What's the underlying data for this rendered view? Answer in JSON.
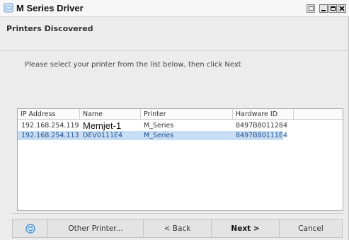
{
  "window": {
    "title": "M Series Driver",
    "header_title": "Printers Discovered",
    "instruction": "Please select your printer from the list below, then click Next"
  },
  "title_icon": "printer-app-icon",
  "list": {
    "columns": [
      "IP Address",
      "Name",
      "Printer",
      "Hardware ID",
      ""
    ],
    "rows": [
      {
        "ip": "192.168.254.119",
        "name": "Memjet-1",
        "printer": "M_Series",
        "hardware_id": "8497B8011284"
      },
      {
        "ip": "192.168.254.113",
        "name": "DEV0111E4",
        "printer": "M_Series",
        "hardware_id": "8497B80111E4"
      }
    ],
    "selected_row": 1
  },
  "buttons": {
    "help_icon": "refresh-help-icon",
    "other_printer": "Other Printer...",
    "back": "< Back",
    "next": "Next >",
    "cancel": "Cancel"
  },
  "colors": {
    "selection_bg": "#c7ddf3",
    "selection_text": "#1e4f8c",
    "window_bg": "#ececec"
  }
}
